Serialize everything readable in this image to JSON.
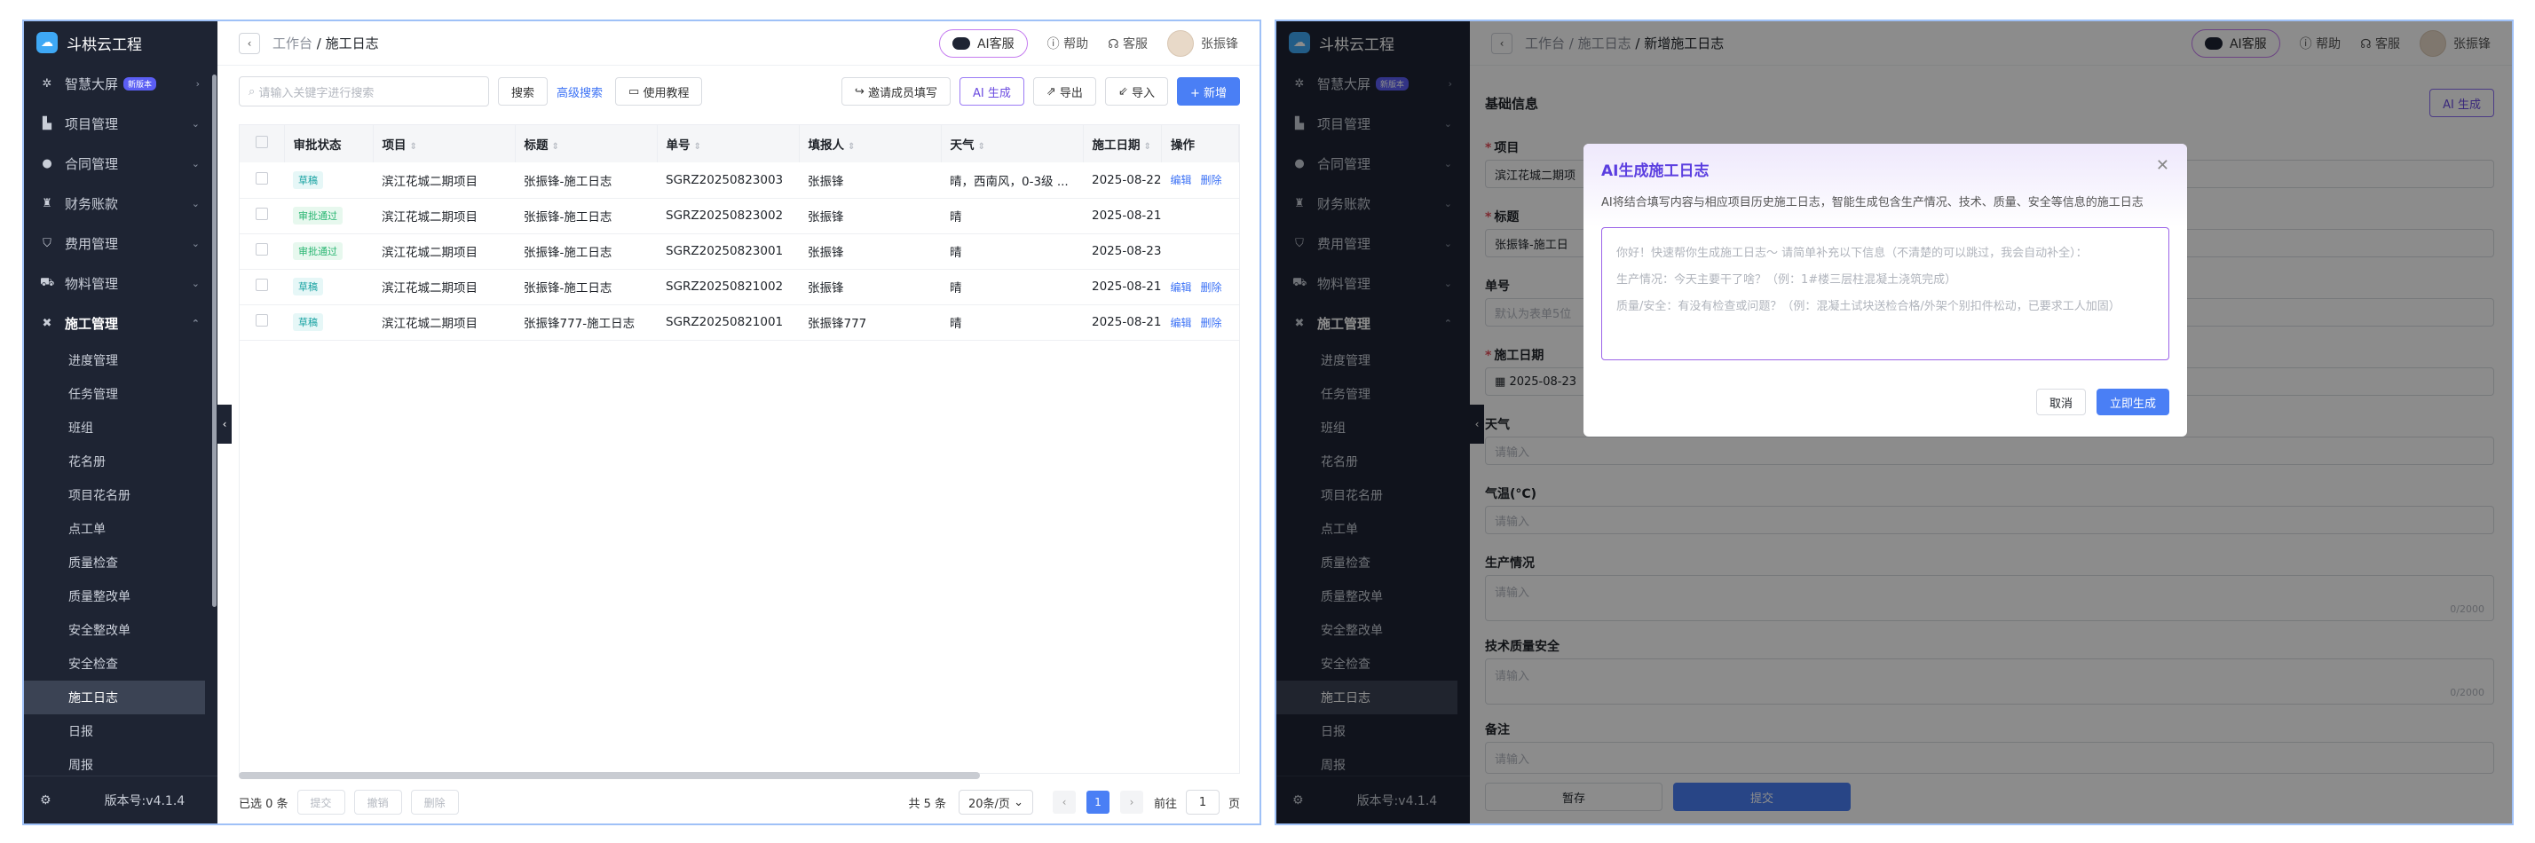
{
  "app_title": "斗栱云工程",
  "version": "版本号:v4.1.4",
  "sidebar": {
    "items": [
      {
        "label": "智慧大屏",
        "badge": "新版本"
      },
      {
        "label": "项目管理"
      },
      {
        "label": "合同管理"
      },
      {
        "label": "财务账款"
      },
      {
        "label": "费用管理"
      },
      {
        "label": "物料管理"
      },
      {
        "label": "施工管理"
      }
    ],
    "sub_items": [
      "进度管理",
      "任务管理",
      "班组",
      "花名册",
      "项目花名册",
      "点工单",
      "质量检查",
      "质量整改单",
      "安全整改单",
      "安全检查",
      "施工日志",
      "日报",
      "周报"
    ],
    "active_sub": "施工日志"
  },
  "header": {
    "crumb_root": "工作台",
    "crumb_list": "/ 施工日志",
    "crumb_sep": "/ 施工日志",
    "crumb_new": "/ 新增施工日志",
    "ai_service": "AI客服",
    "help": "帮助",
    "service": "客服",
    "user": "张振锋"
  },
  "toolbar": {
    "search_placeholder": "请输入关键字进行搜索",
    "search_btn": "搜索",
    "adv_search": "高级搜索",
    "tutorial": "使用教程",
    "invite": "邀请成员填写",
    "ai_gen": "AI 生成",
    "export": "导出",
    "import": "导入",
    "add": "+ 新增"
  },
  "table": {
    "columns": [
      "审批状态",
      "项目",
      "标题",
      "单号",
      "填报人",
      "天气",
      "施工日期",
      "操作"
    ],
    "rows": [
      {
        "status": "草稿",
        "status_type": "draft",
        "project": "滨江花城二期项目",
        "title": "张振锋-施工日志",
        "no": "SGRZ20250823003",
        "reporter": "张振锋",
        "weather": "晴，西南风，0-3级 ...",
        "date": "2025-08-22",
        "ops": [
          "编辑",
          "删除"
        ]
      },
      {
        "status": "审批通过",
        "status_type": "pass",
        "project": "滨江花城二期项目",
        "title": "张振锋-施工日志",
        "no": "SGRZ20250823002",
        "reporter": "张振锋",
        "weather": "晴",
        "date": "2025-08-21",
        "ops": []
      },
      {
        "status": "审批通过",
        "status_type": "pass",
        "project": "滨江花城二期项目",
        "title": "张振锋-施工日志",
        "no": "SGRZ20250823001",
        "reporter": "张振锋",
        "weather": "晴",
        "date": "2025-08-23",
        "ops": []
      },
      {
        "status": "草稿",
        "status_type": "draft",
        "project": "滨江花城二期项目",
        "title": "张振锋-施工日志",
        "no": "SGRZ20250821002",
        "reporter": "张振锋",
        "weather": "晴",
        "date": "2025-08-21",
        "ops": [
          "编辑",
          "删除"
        ]
      },
      {
        "status": "草稿",
        "status_type": "draft",
        "project": "滨江花城二期项目",
        "title": "张振锋777-施工日志",
        "no": "SGRZ20250821001",
        "reporter": "张振锋777",
        "weather": "晴",
        "date": "2025-08-21",
        "ops": [
          "编辑",
          "删除"
        ]
      }
    ]
  },
  "footer": {
    "selected": "已选 0 条",
    "submit": "提交",
    "revoke": "撤销",
    "delete": "删除",
    "total": "共 5 条",
    "page_size": "20条/页",
    "current_page": "1",
    "goto_prefix": "前往",
    "goto_suffix": "页"
  },
  "form": {
    "section": "基础信息",
    "ai_btn": "AI 生成",
    "project_label": "项目",
    "project_value": "滨江花城二期项",
    "title_label": "标题",
    "title_value": "张振锋-施工日",
    "no_label": "单号",
    "no_placeholder": "默认为表单5位",
    "date_label": "施工日期",
    "date_value": "2025-08-23",
    "weather_label": "天气",
    "weather_placeholder": "请输入",
    "temp_label": "气温(°C)",
    "temp_placeholder": "请输入",
    "prod_label": "生产情况",
    "prod_placeholder": "请输入",
    "tech_label": "技术质量安全",
    "tech_placeholder": "请输入",
    "remark_label": "备注",
    "remark_placeholder": "请输入",
    "counter": "0/2000",
    "save": "暂存",
    "submit": "提交"
  },
  "modal": {
    "title": "AI生成施工日志",
    "desc": "AI将结合填写内容与相应项目历史施工日志，智能生成包含生产情况、技术、质量、安全等信息的施工日志",
    "line1": "你好！快速帮你生成施工日志～ 请简单补充以下信息（不清楚的可以跳过，我会自动补全）：",
    "line2": "生产情况：今天主要干了啥？（例：1#楼三层柱混凝土浇筑完成）",
    "line3": "质量/安全：有没有检查或问题？（例：混凝土试块送检合格/外架个别扣件松动，已要求工人加固）",
    "cancel": "取消",
    "generate": "立即生成"
  }
}
